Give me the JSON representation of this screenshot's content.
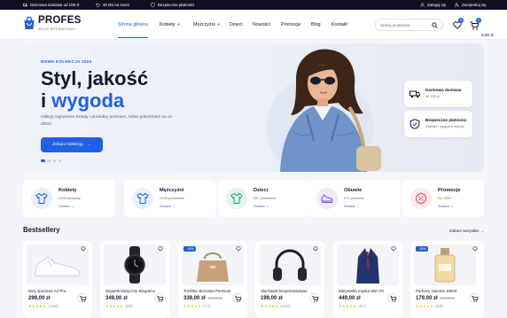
{
  "topbar": {
    "shipping": "Darmowa dostawa od 199 zł",
    "returns": "30 dni na zwrot",
    "payments": "Bezpieczne płatności",
    "login": "Zaloguj się",
    "register": "Zarejestruj się"
  },
  "brand": {
    "name": "PROFES",
    "tagline": "SKLEP INTERNETOWY",
    "accent_color": "#2160e0"
  },
  "nav": [
    "Strona główna",
    "Kobiety",
    "Mężczyźni",
    "Dzieci",
    "Nowości",
    "Promocje",
    "Blog",
    "Kontakt"
  ],
  "search": {
    "placeholder": "Szukaj produktów..."
  },
  "header_actions": {
    "wishlist_count": "0",
    "cart_count": "0",
    "cart_total": "0,00 zł"
  },
  "hero": {
    "tag": "NOWA KOLEKCJA 2024",
    "title_line1": "Styl, jakość",
    "title_i": "i",
    "title_accent": "wygoda",
    "description": "Odkryj najnowsze trendy i produkty premium, które pokochasz na co dzień.",
    "cta": "Zobacz kolekcję",
    "features": [
      {
        "title": "Darmowa dostawa",
        "subtitle": "od 199 zł",
        "icon": "truck-icon"
      },
      {
        "title": "Bezpieczne płatności",
        "subtitle": "Szybkie i wygodne zwroty",
        "icon": "shield-check-icon"
      }
    ]
  },
  "categories": [
    {
      "name": "Kobiety",
      "count": "1403 produkty",
      "link": "Zobacz →",
      "color": "#e8f0fd",
      "icon": "tshirt-icon"
    },
    {
      "name": "Mężczyźni",
      "count": "2108 produktów",
      "link": "Zobacz →",
      "color": "#e8f0fd",
      "icon": "tshirt-icon"
    },
    {
      "name": "Dzieci",
      "count": "987 produktów",
      "link": "Zobacz →",
      "color": "#e4f6ef",
      "icon": "kids-shirt-icon"
    },
    {
      "name": "Obuwie",
      "count": "674 produkty",
      "link": "Zobacz →",
      "color": "#f0eafd",
      "icon": "shoe-icon"
    },
    {
      "name": "Promocje",
      "count": "Do -50%",
      "link": "Zobacz →",
      "color": "#fdeaed",
      "icon": "percent-icon"
    }
  ],
  "bestsellers": {
    "title": "Bestsellery",
    "see_all": "Zobacz wszystkie →",
    "products": [
      {
        "name": "Buty sportowe Air Pro",
        "price": "299,00 zł",
        "old_price": "",
        "badge": "",
        "stars": "★★★★★",
        "reviews": "(128)",
        "image": "sneaker"
      },
      {
        "name": "Zegarek klasyczny Elegance",
        "price": "349,00 zł",
        "old_price": "",
        "badge": "",
        "stars": "★★★★★",
        "reviews": "(96)",
        "image": "watch"
      },
      {
        "name": "Torebka skórzana Premium",
        "price": "339,00 zł",
        "old_price": "399,00 zł",
        "badge": "-15%",
        "stars": "★★★★★",
        "reviews": "(74)",
        "image": "handbag"
      },
      {
        "name": "Słuchawki bezprzewodowe",
        "price": "199,00 zł",
        "old_price": "",
        "badge": "",
        "stars": "★★★★★",
        "reviews": "(203)",
        "image": "headphones"
      },
      {
        "name": "Marynarka męska Slim Fit",
        "price": "449,00 zł",
        "old_price": "",
        "badge": "",
        "stars": "★★★★★",
        "reviews": "(67)",
        "image": "blazer"
      },
      {
        "name": "Perfumy Homme 100ml",
        "price": "179,00 zł",
        "old_price": "209,00 zł",
        "badge": "-15%",
        "stars": "★★★★★",
        "reviews": "(58)",
        "image": "perfume"
      }
    ]
  }
}
